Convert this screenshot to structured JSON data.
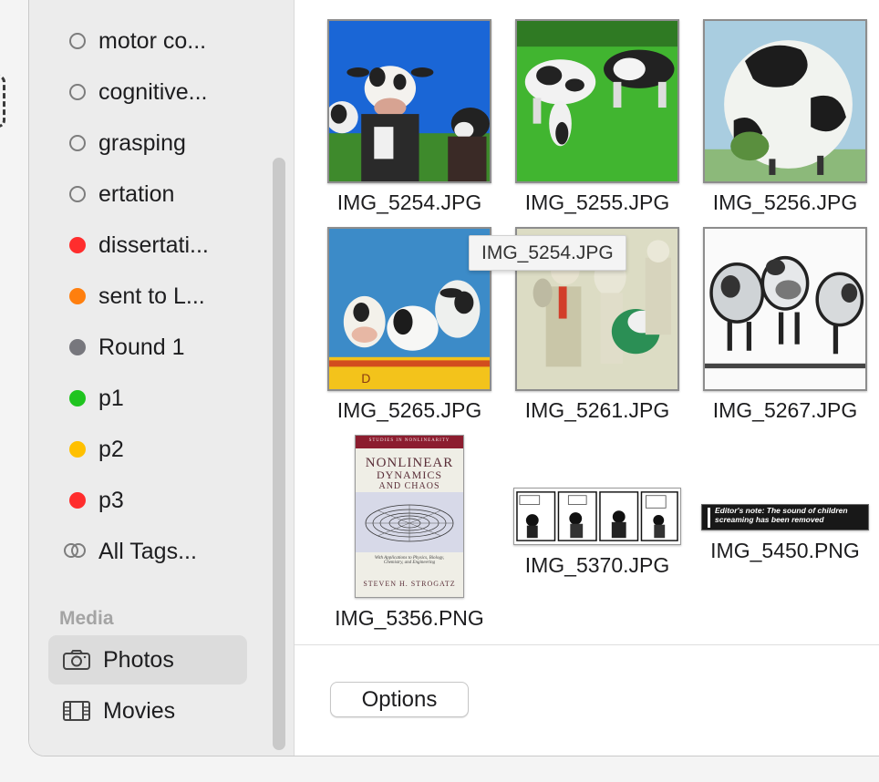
{
  "sidebar": {
    "tags": [
      {
        "label": "motor co...",
        "color": "",
        "hollow": true
      },
      {
        "label": "cognitive...",
        "color": "",
        "hollow": true
      },
      {
        "label": "grasping",
        "color": "",
        "hollow": true
      },
      {
        "label": "ertation",
        "color": "",
        "hollow": true
      },
      {
        "label": "dissertati...",
        "color": "#ff2d2d",
        "hollow": false
      },
      {
        "label": "sent to L...",
        "color": "#ff7f0e",
        "hollow": false
      },
      {
        "label": "Round 1",
        "color": "#77777d",
        "hollow": false
      },
      {
        "label": "p1",
        "color": "#1fc41f",
        "hollow": false
      },
      {
        "label": "p2",
        "color": "#ffc000",
        "hollow": false
      },
      {
        "label": "p3",
        "color": "#ff2d2d",
        "hollow": false
      }
    ],
    "all_tags_label": "All Tags...",
    "media_header": "Media",
    "media_items": [
      {
        "label": "Photos",
        "icon": "camera-icon",
        "selected": true
      },
      {
        "label": "Movies",
        "icon": "film-icon",
        "selected": false
      }
    ]
  },
  "files": [
    {
      "name": "IMG_5254.JPG",
      "image": "cows-closeup-blue-sky"
    },
    {
      "name": "IMG_5255.JPG",
      "image": "cows-grazing-field"
    },
    {
      "name": "IMG_5256.JPG",
      "image": "round-cow-sphere"
    },
    {
      "name": "IMG_5265.JPG",
      "image": "cows-wagon"
    },
    {
      "name": "IMG_5261.JPG",
      "image": "cow-figures-lab-coats"
    },
    {
      "name": "IMG_5267.JPG",
      "image": "chrome-cows"
    },
    {
      "name": "IMG_5356.PNG",
      "image": "book-cover"
    },
    {
      "name": "IMG_5370.JPG",
      "image": "comic-strip"
    },
    {
      "name": "IMG_5450.PNG",
      "image": "caption-banner"
    }
  ],
  "book": {
    "series": "STUDIES IN NONLINEARITY",
    "title_lines": [
      "NONLINEAR",
      "DYNAMICS",
      "AND CHAOS"
    ],
    "subtitle": "With Applications to Physics, Biology, Chemistry, and Engineering",
    "author": "STEVEN H. STROGATZ"
  },
  "banner_text": "Editor's note: The sound of children screaming has been removed",
  "tooltip": "IMG_5254.JPG",
  "options_label": "Options"
}
